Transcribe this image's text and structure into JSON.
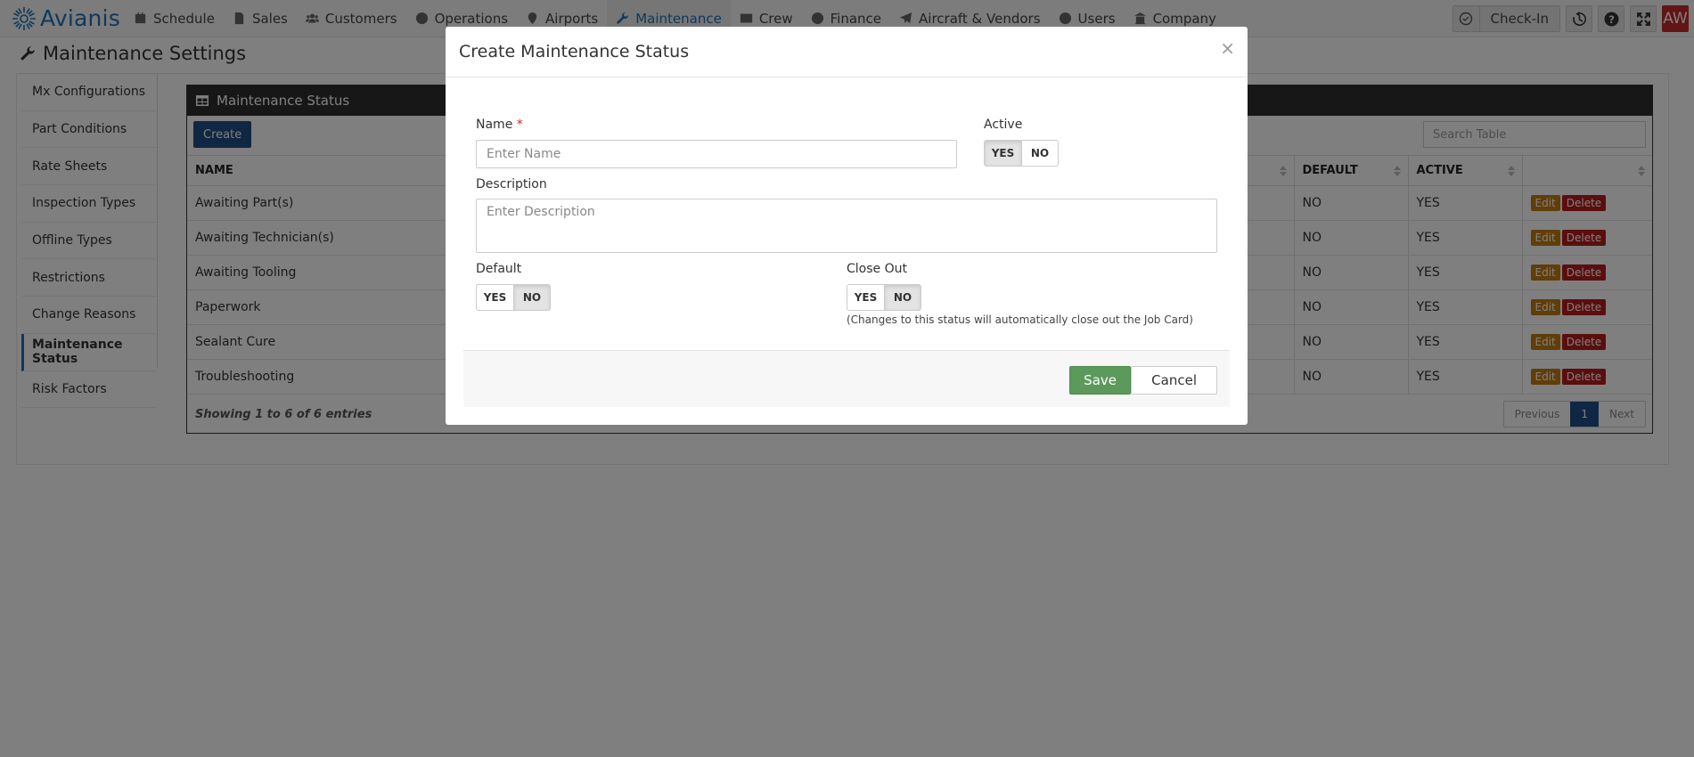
{
  "brand": {
    "name": "Avianis"
  },
  "nav": [
    {
      "label": "Schedule",
      "icon": "calendar-icon"
    },
    {
      "label": "Sales",
      "icon": "document-icon"
    },
    {
      "label": "Customers",
      "icon": "users-icon"
    },
    {
      "label": "Operations",
      "icon": "globe-icon"
    },
    {
      "label": "Airports",
      "icon": "map-marker-icon"
    },
    {
      "label": "Maintenance",
      "icon": "wrench-icon"
    },
    {
      "label": "Crew",
      "icon": "id-card-icon"
    },
    {
      "label": "Finance",
      "icon": "dollar-icon"
    },
    {
      "label": "Aircraft & Vendors",
      "icon": "plane-icon"
    },
    {
      "label": "Users",
      "icon": "user-circle-icon"
    },
    {
      "label": "Company",
      "icon": "building-icon"
    }
  ],
  "header_right": {
    "checkin_label": "Check-In",
    "avatar_initials": "AW"
  },
  "page": {
    "title": "Maintenance Settings"
  },
  "sidenav": [
    "Mx Configurations",
    "Part Conditions",
    "Rate Sheets",
    "Inspection Types",
    "Offline Types",
    "Restrictions",
    "Change Reasons",
    "Maintenance Status",
    "Risk Factors"
  ],
  "panel": {
    "title": "Maintenance Status",
    "create_label": "Create",
    "search_placeholder": "Search Table",
    "columns": {
      "name": "NAME",
      "default": "DEFAULT",
      "active": "ACTIVE"
    },
    "rows": [
      {
        "name": "Awaiting Part(s)",
        "default": "NO",
        "active": "YES"
      },
      {
        "name": "Awaiting Technician(s)",
        "default": "NO",
        "active": "YES"
      },
      {
        "name": "Awaiting Tooling",
        "default": "NO",
        "active": "YES"
      },
      {
        "name": "Paperwork",
        "default": "NO",
        "active": "YES"
      },
      {
        "name": "Sealant Cure",
        "default": "NO",
        "active": "YES"
      },
      {
        "name": "Troubleshooting",
        "default": "NO",
        "active": "YES"
      }
    ],
    "edit_label": "Edit",
    "delete_label": "Delete",
    "showing": "Showing 1 to 6 of 6 entries",
    "pager": {
      "previous": "Previous",
      "current": "1",
      "next": "Next"
    }
  },
  "modal": {
    "title": "Create Maintenance Status",
    "close": "×",
    "name_label": "Name",
    "name_required": "*",
    "name_placeholder": "Enter Name",
    "active_label": "Active",
    "active_value": "YES",
    "description_label": "Description",
    "description_placeholder": "Enter Description",
    "default_label": "Default",
    "default_value": "NO",
    "closeout_label": "Close Out",
    "closeout_value": "NO",
    "closeout_hint": "(Changes to this status will automatically close out the Job Card)",
    "yes": "YES",
    "no": "NO",
    "save_label": "Save",
    "cancel_label": "Cancel"
  }
}
